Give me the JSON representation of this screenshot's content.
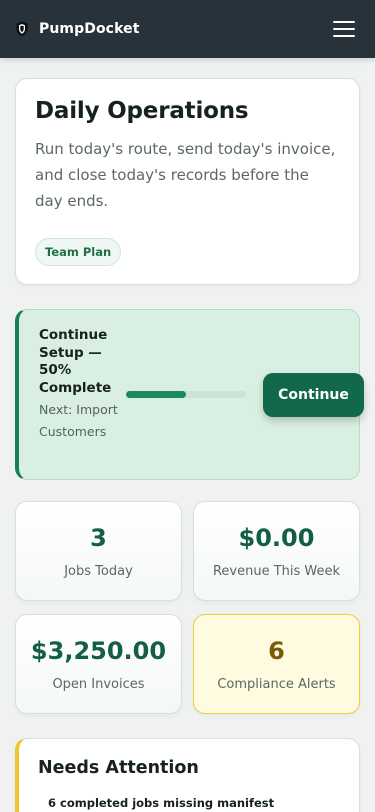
{
  "header": {
    "brand": "PumpDocket",
    "logo_icon": "shield-icon",
    "menu_icon": "hamburger-menu-icon"
  },
  "hero": {
    "title": "Daily Operations",
    "description": "Run today's route, send today's invoice, and close today's records before the day ends.",
    "plan_badge": "Team Plan"
  },
  "setup": {
    "title": "Continue Setup — 50% Complete",
    "next": "Next: Import Customers",
    "progress_percent": 50,
    "continue_label": "Continue"
  },
  "stats": [
    {
      "value": "3",
      "label": "Jobs Today"
    },
    {
      "value": "$0.00",
      "label": "Revenue This Week"
    },
    {
      "value": "$3,250.00",
      "label": "Open Invoices"
    },
    {
      "value": "6",
      "label": "Compliance Alerts"
    }
  ],
  "attention": {
    "title": "Needs Attention",
    "items": [
      "6 completed jobs missing manifest"
    ]
  },
  "colors": {
    "header_bg": "#27323a",
    "accent_green": "#11684a",
    "warning_yellow": "#f1c52a"
  }
}
